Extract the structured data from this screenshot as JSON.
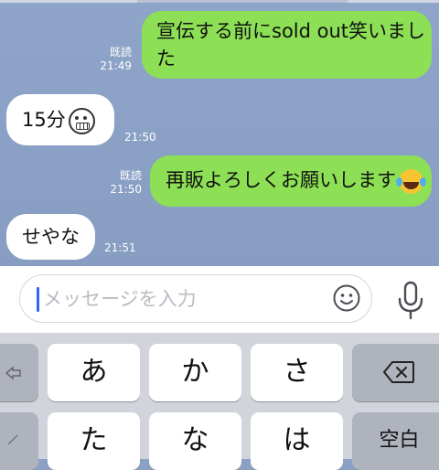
{
  "messages": [
    {
      "side": "out",
      "text_line1": "宣伝する前にsold out笑いまし",
      "text_line2": "た",
      "read": "既読",
      "time": "21:49"
    },
    {
      "side": "in",
      "text": "15分",
      "emoji": "grimacing-face-icon",
      "time": "21:50"
    },
    {
      "side": "out",
      "text": "再販よろしくお願いします",
      "emoji": "tears-of-joy-icon",
      "read": "既読",
      "time": "21:50"
    },
    {
      "side": "in",
      "text": "せやな",
      "time": "21:51"
    }
  ],
  "input": {
    "placeholder": "メッセージを入力",
    "emoji_icon": "smiley-icon",
    "mic_icon": "microphone-icon"
  },
  "keyboard": {
    "row1": [
      {
        "label": "",
        "icon": "undo-arrow-icon"
      },
      {
        "label": "あ"
      },
      {
        "label": "か"
      },
      {
        "label": "さ"
      },
      {
        "label": "",
        "icon": "delete-icon"
      }
    ],
    "row2": [
      {
        "label": "",
        "icon": "next-candidate-icon"
      },
      {
        "label": "た"
      },
      {
        "label": "な"
      },
      {
        "label": "は"
      },
      {
        "label": "空白"
      }
    ]
  },
  "colors": {
    "chat_bg": "#8ea4c8",
    "outgoing_bubble": "#8de055",
    "incoming_bubble": "#ffffff",
    "caret": "#2e67f0",
    "keyboard_bg": "#d1d4da"
  }
}
